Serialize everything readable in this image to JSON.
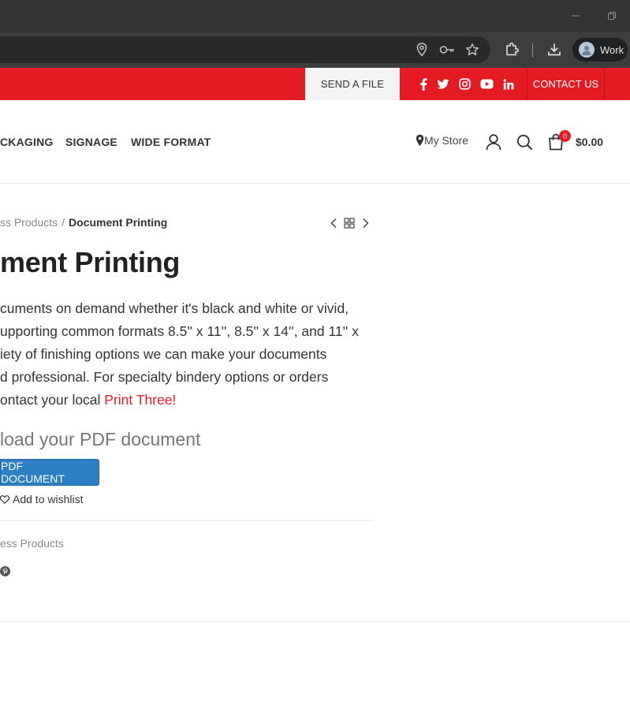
{
  "browser": {
    "profile_label": "Work",
    "icons": [
      "location-icon",
      "key-icon",
      "star-icon",
      "extensions-icon",
      "download-icon",
      "minimize-icon",
      "restore-icon"
    ]
  },
  "topbar": {
    "send_file_label": "SEND A FILE",
    "social_icons": [
      "facebook-icon",
      "twitter-icon",
      "instagram-icon",
      "youtube-icon",
      "linkedin-icon"
    ],
    "contact_label": "CONTACT US",
    "colors": {
      "bar": "#e51b24",
      "send_file_bg": "#f3f3f3"
    }
  },
  "header": {
    "nav": [
      {
        "label": "CKAGING"
      },
      {
        "label": "SIGNAGE"
      },
      {
        "label": "WIDE FORMAT"
      }
    ],
    "store_label": "My Store",
    "cart_count": "0",
    "cart_total": "$0.00"
  },
  "breadcrumb": {
    "parent": "ss Products",
    "separator": "/",
    "current": "Document Printing"
  },
  "product": {
    "title": "ment Printing",
    "description_lines": [
      "cuments on demand whether it's black and white or vivid,",
      "upporting common formats 8.5'' x 11'', 8.5'' x 14'', and 11'' x",
      "iety of finishing options we can make your documents",
      "d professional. For specialty bindery options or orders",
      "ontact your local "
    ],
    "description_link": "Print Three!",
    "upload_heading": "load your PDF document",
    "upload_button": "PDF DOCUMENT",
    "wishlist_label": "Add to wishlist",
    "category": "ess Products",
    "colors": {
      "accent": "#e51b24",
      "button": "#2d7fc3"
    }
  }
}
